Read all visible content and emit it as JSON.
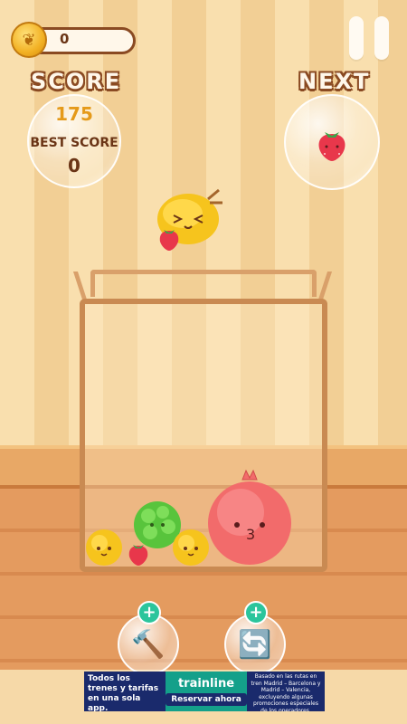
{
  "coins": {
    "value": "0"
  },
  "labels": {
    "score": "SCORE",
    "next": "NEXT",
    "best_score": "BEST SCORE"
  },
  "score": {
    "value": "175",
    "best": "0"
  },
  "powerups": {
    "plus": "+"
  },
  "ad": {
    "left_text": "Todos los trenes y tarifas en una sola app.",
    "brand": "trainline",
    "cta": "Reservar ahora",
    "right_text": "Basado en las rutas en tren Madrid – Barcelona y Madrid – Valencia, excluyendo algunas promociones especiales de los operadores."
  },
  "icons": {
    "coin": "coin-icon",
    "pause": "pause-icon",
    "hammer": "hammer-icon",
    "shuffle": "shuffle-icon"
  },
  "colors": {
    "score_value": "#e59a1a",
    "label_outline": "#8a4a22",
    "plus_badge": "#2bc59c"
  }
}
